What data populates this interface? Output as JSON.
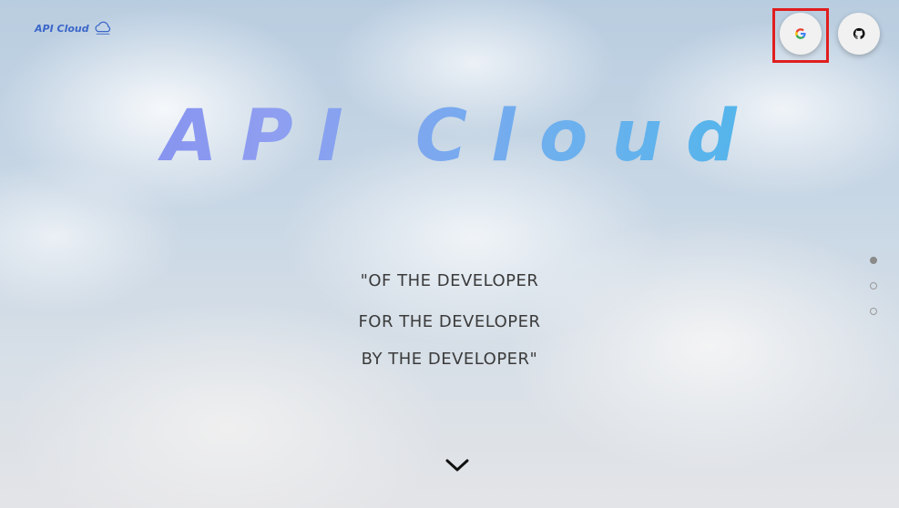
{
  "brand": {
    "name": "API Cloud",
    "icon": "cloud-icon",
    "color": "#3b66c9"
  },
  "auth": {
    "google": {
      "icon": "google-icon",
      "highlighted": true,
      "highlight_color": "#e01e1e"
    },
    "github": {
      "icon": "github-icon"
    }
  },
  "hero": {
    "title": "API Cloud",
    "gradient": [
      "#7b87f0",
      "#3fb9e8"
    ],
    "slogan": [
      "\"OF THE DEVELOPER",
      "FOR THE DEVELOPER",
      "BY THE DEVELOPER\""
    ]
  },
  "pagination": {
    "count": 3,
    "active_index": 0
  },
  "scroll": {
    "icon": "chevron-down-icon"
  }
}
